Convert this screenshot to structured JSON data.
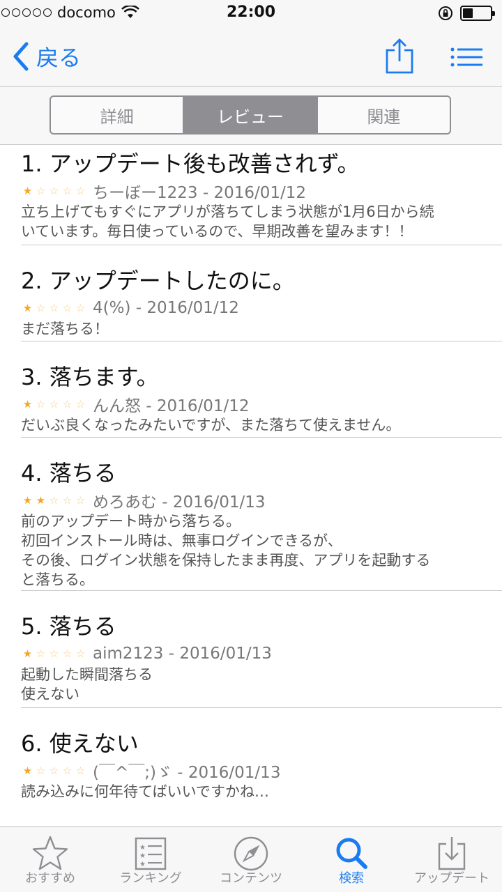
{
  "status": {
    "carrier": "docomo",
    "time": "22:00"
  },
  "nav": {
    "back_label": "戻る"
  },
  "segments": [
    {
      "label": "詳細",
      "active": false
    },
    {
      "label": "レビュー",
      "active": true
    },
    {
      "label": "関連",
      "active": false
    }
  ],
  "reviews": [
    {
      "title": "1. アップデート後も改善されず。",
      "rating": 1,
      "meta": "ちーぼー1223 - 2016/01/12",
      "body": "立ち上げてもすぐにアプリが落ちてしまう状態が1月6日から続\nいています。毎日使っているので、早期改善を望みます！！"
    },
    {
      "title": "2. アップデートしたのに。",
      "rating": 1,
      "meta": "4(%) - 2016/01/12",
      "body": "まだ落ちる！"
    },
    {
      "title": "3. 落ちます。",
      "rating": 1,
      "meta": "んん怒 - 2016/01/12",
      "body": "だいぶ良くなったみたいですが、また落ちて使えません。"
    },
    {
      "title": "4. 落ちる",
      "rating": 2,
      "meta": "めろあむ - 2016/01/13",
      "body": "前のアップデート時から落ちる。\n初回インストール時は、無事ログインできるが、\nその後、ログイン状態を保持したまま再度、アプリを起動する\nと落ちる。"
    },
    {
      "title": "5. 落ちる",
      "rating": 1,
      "meta": "aim2123 - 2016/01/13",
      "body": "起動した瞬間落ちる\n使えない"
    },
    {
      "title": "6. 使えない",
      "rating": 1,
      "meta": "(￣^￣;)ゞ - 2016/01/13",
      "body": "読み込みに何年待てばいいですかね…"
    }
  ],
  "tabs": [
    {
      "label": "おすすめ",
      "icon": "star-icon",
      "active": false
    },
    {
      "label": "ランキング",
      "icon": "ranking-list-icon",
      "active": false
    },
    {
      "label": "コンテンツ",
      "icon": "compass-icon",
      "active": false
    },
    {
      "label": "検索",
      "icon": "search-icon",
      "active": true
    },
    {
      "label": "アップデート",
      "icon": "download-tray-icon",
      "active": false
    }
  ],
  "colors": {
    "accent": "#1a7cf0",
    "star": "#f5a623",
    "inactive": "#8e8e93"
  }
}
